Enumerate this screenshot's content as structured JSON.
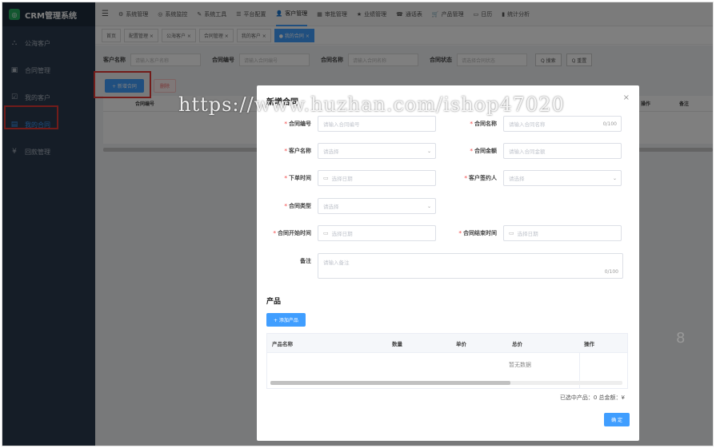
{
  "app": {
    "title": "CRM管理系统"
  },
  "sidebar": {
    "items": [
      {
        "label": "公海客户",
        "icon": "⛬"
      },
      {
        "label": "合同管理",
        "icon": "▣"
      },
      {
        "label": "我的客户",
        "icon": "☑"
      },
      {
        "label": "我的合同",
        "icon": "▤",
        "active": true
      },
      {
        "label": "回款管理",
        "icon": "¥"
      }
    ]
  },
  "topnav": {
    "items": [
      {
        "label": "系统管理",
        "icon": "⚙"
      },
      {
        "label": "系统监控",
        "icon": "◎"
      },
      {
        "label": "系统工具",
        "icon": "✎"
      },
      {
        "label": "平台配置",
        "icon": "☰"
      },
      {
        "label": "客户管理",
        "icon": "👤",
        "active": true
      },
      {
        "label": "审批管理",
        "icon": "▦"
      },
      {
        "label": "业绩管理",
        "icon": "★"
      },
      {
        "label": "通话表",
        "icon": "☎"
      },
      {
        "label": "产品管理",
        "icon": "🛒"
      },
      {
        "label": "日历",
        "icon": "▭"
      },
      {
        "label": "统计分析",
        "icon": "▮"
      }
    ]
  },
  "tags": [
    "首页",
    "配置管理 ×",
    "公海客户 ×",
    "合同管理 ×",
    "我的客户 ×",
    "● 我的合同 ×"
  ],
  "filters": {
    "customer_name_label": "客户名称",
    "customer_name_ph": "请输入客户名称",
    "contract_no_label": "合同编号",
    "contract_no_ph": "请输入合同编号",
    "contract_name_label": "合同名称",
    "contract_name_ph": "请输入合同名称",
    "contract_status_label": "合同状态",
    "contract_status_ph": "请选择合同状态",
    "search_label": "Q 搜索",
    "reset_label": "Q 重置"
  },
  "actions": {
    "add_label": "+ 新增合同",
    "delete_label": "删除"
  },
  "table": {
    "headers": [
      "合同编号",
      "操作",
      "备注"
    ]
  },
  "watermark": "https://www.huzhan.com/ishop47020",
  "edge_mark": "8",
  "modal": {
    "title": "新增合同",
    "close": "×",
    "fields": {
      "contract_no": {
        "label": "合同编号",
        "placeholder": "请输入合同编号"
      },
      "contract_name": {
        "label": "合同名称",
        "placeholder": "请输入合同名称",
        "counter": "0/100"
      },
      "customer_name": {
        "label": "客户名称",
        "placeholder": "请选择"
      },
      "contract_amount": {
        "label": "合同金额",
        "placeholder": "请输入合同金额"
      },
      "order_time": {
        "label": "下单时间",
        "placeholder": "选择日期"
      },
      "signer": {
        "label": "客户签约人",
        "placeholder": "请选择"
      },
      "contract_type": {
        "label": "合同类型",
        "placeholder": "请选择"
      },
      "start_time": {
        "label": "合同开始时间",
        "placeholder": "选择日期"
      },
      "end_time": {
        "label": "合同结束时间",
        "placeholder": "选择日期"
      },
      "remark": {
        "label": "备注",
        "placeholder": "请输入备注",
        "counter": "0/100"
      }
    },
    "products": {
      "section_title": "产品",
      "add_label": "+ 添加产品",
      "headers": [
        "产品名称",
        "数量",
        "单价",
        "总价",
        "操作"
      ],
      "empty_text": "暂无数据",
      "summary": "已选中产品：0 总金额：¥"
    },
    "confirm_label": "确 定"
  }
}
